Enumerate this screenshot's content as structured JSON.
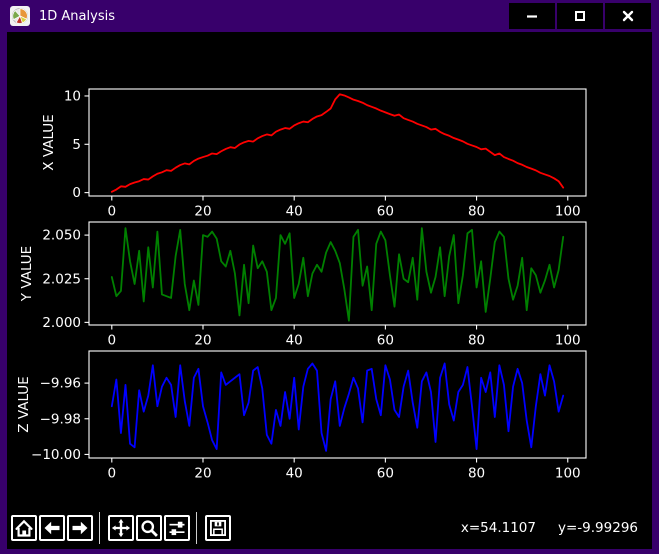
{
  "titlebar": {
    "title": "1D Analysis",
    "icon": "matplotlib-logo-icon",
    "window_buttons": [
      {
        "name": "minimize",
        "icon": "minimize-icon"
      },
      {
        "name": "maximize",
        "icon": "maximize-icon"
      },
      {
        "name": "close",
        "icon": "close-icon"
      }
    ]
  },
  "toolbar": {
    "buttons": [
      {
        "name": "home",
        "icon": "home-icon"
      },
      {
        "name": "back",
        "icon": "arrow-left-icon"
      },
      {
        "name": "forward",
        "icon": "arrow-right-icon"
      },
      {
        "name": "pan",
        "icon": "move-icon"
      },
      {
        "name": "zoom",
        "icon": "magnifier-icon"
      },
      {
        "name": "configure-subplots",
        "icon": "sliders-icon"
      },
      {
        "name": "save",
        "icon": "floppy-icon"
      }
    ],
    "status": {
      "x": "x=54.1107",
      "y": "y=-9.99296"
    }
  },
  "colors": {
    "titlebar": "#38006B",
    "window_border": "#38006B",
    "background": "#000000",
    "foreground": "#FFFFFF",
    "x_series": "#FF0000",
    "y_series": "#008000",
    "z_series": "#0000FF"
  },
  "chart_data": [
    {
      "type": "line",
      "ylabel": "X VALUE",
      "color": "#FF0000",
      "x_start": 0,
      "x_step": 1,
      "xlim": [
        -5,
        104
      ],
      "ylim": [
        -0.35,
        10.72
      ],
      "xticks": [
        0,
        20,
        40,
        60,
        80,
        100
      ],
      "yticks": [
        0,
        5,
        10
      ],
      "ytick_labels": [
        "0",
        "5",
        "10"
      ],
      "values": [
        0.08,
        0.32,
        0.65,
        0.6,
        0.88,
        1.05,
        1.18,
        1.4,
        1.35,
        1.68,
        1.95,
        2.1,
        2.32,
        2.25,
        2.58,
        2.85,
        3.02,
        2.92,
        3.28,
        3.52,
        3.68,
        3.82,
        4.05,
        3.98,
        4.28,
        4.52,
        4.7,
        4.62,
        4.98,
        5.2,
        5.35,
        5.28,
        5.62,
        5.85,
        6.02,
        5.92,
        6.3,
        6.52,
        6.68,
        6.6,
        6.95,
        7.18,
        7.35,
        7.28,
        7.62,
        7.88,
        8.02,
        8.35,
        8.7,
        9.65,
        10.18,
        10.05,
        9.85,
        9.62,
        9.48,
        9.3,
        9.05,
        8.88,
        8.7,
        8.48,
        8.3,
        8.12,
        7.95,
        8.08,
        7.7,
        7.52,
        7.35,
        7.12,
        6.95,
        6.78,
        6.52,
        6.6,
        6.28,
        6.05,
        5.88,
        5.65,
        5.48,
        5.3,
        5.05,
        4.88,
        4.72,
        4.48,
        4.55,
        4.22,
        3.88,
        4.05,
        3.68,
        3.48,
        3.3,
        3.05,
        2.88,
        2.65,
        2.48,
        2.3,
        2.05,
        1.88,
        1.72,
        1.48,
        1.18,
        0.52
      ]
    },
    {
      "type": "line",
      "ylabel": "Y VALUE",
      "color": "#008000",
      "x_start": 0,
      "x_step": 1,
      "xlim": [
        -5,
        104
      ],
      "ylim": [
        1.9985,
        2.0575
      ],
      "xticks": [
        0,
        20,
        40,
        60,
        80,
        100
      ],
      "yticks": [
        2.0,
        2.025,
        2.05
      ],
      "ytick_labels": [
        "2.000",
        "2.025",
        "2.050"
      ],
      "values": [
        2.026,
        2.015,
        2.018,
        2.054,
        2.035,
        2.022,
        2.041,
        2.012,
        2.043,
        2.02,
        2.052,
        2.016,
        2.015,
        2.014,
        2.038,
        2.053,
        2.022,
        2.007,
        2.024,
        2.01,
        2.05,
        2.049,
        2.052,
        2.048,
        2.035,
        2.032,
        2.041,
        2.028,
        2.004,
        2.033,
        2.011,
        2.044,
        2.031,
        2.035,
        2.029,
        2.007,
        2.014,
        2.05,
        2.045,
        2.051,
        2.014,
        2.022,
        2.037,
        2.015,
        2.028,
        2.033,
        2.029,
        2.04,
        2.046,
        2.041,
        2.034,
        2.019,
        2.001,
        2.049,
        2.053,
        2.021,
        2.032,
        2.007,
        2.045,
        2.052,
        2.047,
        2.027,
        2.009,
        2.039,
        2.025,
        2.023,
        2.037,
        2.013,
        2.054,
        2.029,
        2.017,
        2.026,
        2.043,
        2.015,
        2.038,
        2.05,
        2.011,
        2.027,
        2.051,
        2.053,
        2.02,
        2.035,
        2.006,
        2.025,
        2.046,
        2.052,
        2.049,
        2.025,
        2.013,
        2.021,
        2.037,
        2.007,
        2.031,
        2.027,
        2.017,
        2.024,
        2.033,
        2.02,
        2.03,
        2.049
      ]
    },
    {
      "type": "line",
      "ylabel": "Z VALUE",
      "color": "#0000FF",
      "x_start": 0,
      "x_step": 1,
      "xlim": [
        -5,
        104
      ],
      "ylim": [
        -10.002,
        -9.942
      ],
      "xticks": [
        0,
        20,
        40,
        60,
        80,
        100
      ],
      "yticks": [
        -10.0,
        -9.98,
        -9.96
      ],
      "ytick_labels": [
        "−10.00",
        "−9.98",
        "−9.96"
      ],
      "values": [
        -9.973,
        -9.958,
        -9.988,
        -9.961,
        -9.994,
        -9.996,
        -9.964,
        -9.976,
        -9.967,
        -9.95,
        -9.973,
        -9.962,
        -9.957,
        -9.961,
        -9.979,
        -9.95,
        -9.97,
        -9.984,
        -9.957,
        -9.952,
        -9.973,
        -9.982,
        -9.992,
        -9.997,
        -9.954,
        -9.961,
        -9.959,
        -9.957,
        -9.955,
        -9.978,
        -9.971,
        -9.953,
        -9.951,
        -9.963,
        -9.989,
        -9.994,
        -9.975,
        -9.984,
        -9.965,
        -9.98,
        -9.957,
        -9.986,
        -9.962,
        -9.952,
        -9.949,
        -9.953,
        -9.988,
        -9.998,
        -9.969,
        -9.959,
        -9.984,
        -9.974,
        -9.966,
        -9.957,
        -9.963,
        -9.982,
        -9.953,
        -9.952,
        -9.969,
        -9.978,
        -9.95,
        -9.958,
        -9.975,
        -9.979,
        -9.962,
        -9.953,
        -9.971,
        -9.985,
        -9.959,
        -9.954,
        -9.965,
        -9.993,
        -9.957,
        -9.949,
        -9.972,
        -9.981,
        -9.965,
        -9.961,
        -9.951,
        -9.973,
        -9.997,
        -9.957,
        -9.965,
        -9.954,
        -9.979,
        -9.95,
        -9.961,
        -9.987,
        -9.962,
        -9.952,
        -9.96,
        -9.981,
        -9.996,
        -9.973,
        -9.955,
        -9.967,
        -9.95,
        -9.959,
        -9.976,
        -9.967
      ]
    }
  ]
}
